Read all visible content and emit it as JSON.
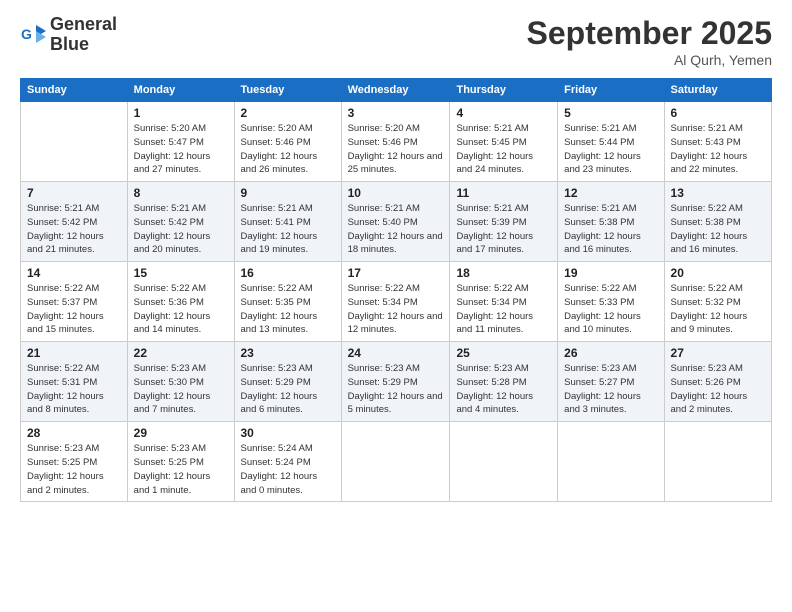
{
  "logo": {
    "line1": "General",
    "line2": "Blue"
  },
  "header": {
    "month": "September 2025",
    "location": "Al Qurh, Yemen"
  },
  "days_of_week": [
    "Sunday",
    "Monday",
    "Tuesday",
    "Wednesday",
    "Thursday",
    "Friday",
    "Saturday"
  ],
  "weeks": [
    [
      {
        "day": "",
        "sunrise": "",
        "sunset": "",
        "daylight": ""
      },
      {
        "day": "1",
        "sunrise": "Sunrise: 5:20 AM",
        "sunset": "Sunset: 5:47 PM",
        "daylight": "Daylight: 12 hours and 27 minutes."
      },
      {
        "day": "2",
        "sunrise": "Sunrise: 5:20 AM",
        "sunset": "Sunset: 5:46 PM",
        "daylight": "Daylight: 12 hours and 26 minutes."
      },
      {
        "day": "3",
        "sunrise": "Sunrise: 5:20 AM",
        "sunset": "Sunset: 5:46 PM",
        "daylight": "Daylight: 12 hours and 25 minutes."
      },
      {
        "day": "4",
        "sunrise": "Sunrise: 5:21 AM",
        "sunset": "Sunset: 5:45 PM",
        "daylight": "Daylight: 12 hours and 24 minutes."
      },
      {
        "day": "5",
        "sunrise": "Sunrise: 5:21 AM",
        "sunset": "Sunset: 5:44 PM",
        "daylight": "Daylight: 12 hours and 23 minutes."
      },
      {
        "day": "6",
        "sunrise": "Sunrise: 5:21 AM",
        "sunset": "Sunset: 5:43 PM",
        "daylight": "Daylight: 12 hours and 22 minutes."
      }
    ],
    [
      {
        "day": "7",
        "sunrise": "Sunrise: 5:21 AM",
        "sunset": "Sunset: 5:42 PM",
        "daylight": "Daylight: 12 hours and 21 minutes."
      },
      {
        "day": "8",
        "sunrise": "Sunrise: 5:21 AM",
        "sunset": "Sunset: 5:42 PM",
        "daylight": "Daylight: 12 hours and 20 minutes."
      },
      {
        "day": "9",
        "sunrise": "Sunrise: 5:21 AM",
        "sunset": "Sunset: 5:41 PM",
        "daylight": "Daylight: 12 hours and 19 minutes."
      },
      {
        "day": "10",
        "sunrise": "Sunrise: 5:21 AM",
        "sunset": "Sunset: 5:40 PM",
        "daylight": "Daylight: 12 hours and 18 minutes."
      },
      {
        "day": "11",
        "sunrise": "Sunrise: 5:21 AM",
        "sunset": "Sunset: 5:39 PM",
        "daylight": "Daylight: 12 hours and 17 minutes."
      },
      {
        "day": "12",
        "sunrise": "Sunrise: 5:21 AM",
        "sunset": "Sunset: 5:38 PM",
        "daylight": "Daylight: 12 hours and 16 minutes."
      },
      {
        "day": "13",
        "sunrise": "Sunrise: 5:22 AM",
        "sunset": "Sunset: 5:38 PM",
        "daylight": "Daylight: 12 hours and 16 minutes."
      }
    ],
    [
      {
        "day": "14",
        "sunrise": "Sunrise: 5:22 AM",
        "sunset": "Sunset: 5:37 PM",
        "daylight": "Daylight: 12 hours and 15 minutes."
      },
      {
        "day": "15",
        "sunrise": "Sunrise: 5:22 AM",
        "sunset": "Sunset: 5:36 PM",
        "daylight": "Daylight: 12 hours and 14 minutes."
      },
      {
        "day": "16",
        "sunrise": "Sunrise: 5:22 AM",
        "sunset": "Sunset: 5:35 PM",
        "daylight": "Daylight: 12 hours and 13 minutes."
      },
      {
        "day": "17",
        "sunrise": "Sunrise: 5:22 AM",
        "sunset": "Sunset: 5:34 PM",
        "daylight": "Daylight: 12 hours and 12 minutes."
      },
      {
        "day": "18",
        "sunrise": "Sunrise: 5:22 AM",
        "sunset": "Sunset: 5:34 PM",
        "daylight": "Daylight: 12 hours and 11 minutes."
      },
      {
        "day": "19",
        "sunrise": "Sunrise: 5:22 AM",
        "sunset": "Sunset: 5:33 PM",
        "daylight": "Daylight: 12 hours and 10 minutes."
      },
      {
        "day": "20",
        "sunrise": "Sunrise: 5:22 AM",
        "sunset": "Sunset: 5:32 PM",
        "daylight": "Daylight: 12 hours and 9 minutes."
      }
    ],
    [
      {
        "day": "21",
        "sunrise": "Sunrise: 5:22 AM",
        "sunset": "Sunset: 5:31 PM",
        "daylight": "Daylight: 12 hours and 8 minutes."
      },
      {
        "day": "22",
        "sunrise": "Sunrise: 5:23 AM",
        "sunset": "Sunset: 5:30 PM",
        "daylight": "Daylight: 12 hours and 7 minutes."
      },
      {
        "day": "23",
        "sunrise": "Sunrise: 5:23 AM",
        "sunset": "Sunset: 5:29 PM",
        "daylight": "Daylight: 12 hours and 6 minutes."
      },
      {
        "day": "24",
        "sunrise": "Sunrise: 5:23 AM",
        "sunset": "Sunset: 5:29 PM",
        "daylight": "Daylight: 12 hours and 5 minutes."
      },
      {
        "day": "25",
        "sunrise": "Sunrise: 5:23 AM",
        "sunset": "Sunset: 5:28 PM",
        "daylight": "Daylight: 12 hours and 4 minutes."
      },
      {
        "day": "26",
        "sunrise": "Sunrise: 5:23 AM",
        "sunset": "Sunset: 5:27 PM",
        "daylight": "Daylight: 12 hours and 3 minutes."
      },
      {
        "day": "27",
        "sunrise": "Sunrise: 5:23 AM",
        "sunset": "Sunset: 5:26 PM",
        "daylight": "Daylight: 12 hours and 2 minutes."
      }
    ],
    [
      {
        "day": "28",
        "sunrise": "Sunrise: 5:23 AM",
        "sunset": "Sunset: 5:25 PM",
        "daylight": "Daylight: 12 hours and 2 minutes."
      },
      {
        "day": "29",
        "sunrise": "Sunrise: 5:23 AM",
        "sunset": "Sunset: 5:25 PM",
        "daylight": "Daylight: 12 hours and 1 minute."
      },
      {
        "day": "30",
        "sunrise": "Sunrise: 5:24 AM",
        "sunset": "Sunset: 5:24 PM",
        "daylight": "Daylight: 12 hours and 0 minutes."
      },
      {
        "day": "",
        "sunrise": "",
        "sunset": "",
        "daylight": ""
      },
      {
        "day": "",
        "sunrise": "",
        "sunset": "",
        "daylight": ""
      },
      {
        "day": "",
        "sunrise": "",
        "sunset": "",
        "daylight": ""
      },
      {
        "day": "",
        "sunrise": "",
        "sunset": "",
        "daylight": ""
      }
    ]
  ]
}
